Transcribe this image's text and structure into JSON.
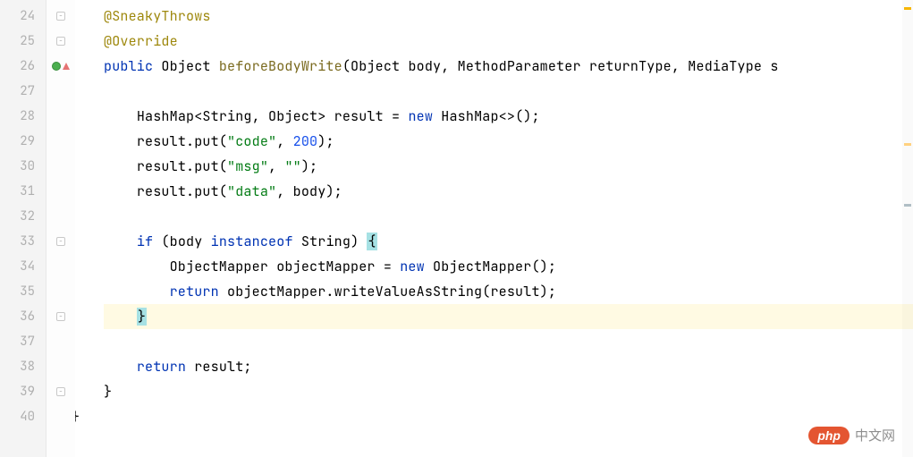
{
  "gutter": {
    "start": 24,
    "end": 40,
    "line26_icon": "override-marker"
  },
  "code": {
    "l24_anno": "@SneakyThrows",
    "l25_anno": "@Override",
    "l26_kw_public": "public",
    "l26_type_object": "Object",
    "l26_method": "beforeBodyWrite",
    "l26_p_object": "Object",
    "l26_p_body": "body",
    "l26_p_mp": "MethodParameter",
    "l26_p_rt": "returnType",
    "l26_p_mt": "MediaType",
    "l26_p_s": "s",
    "l28_type_hm": "HashMap",
    "l28_gen_str": "String",
    "l28_gen_obj": "Object",
    "l28_var": "result",
    "l28_kw_new": "new",
    "l28_ctor": "HashMap",
    "l29_recv": "result",
    "l29_put": "put",
    "l29_key": "\"code\"",
    "l29_val": "200",
    "l30_recv": "result",
    "l30_put": "put",
    "l30_key": "\"msg\"",
    "l30_val": "\"\"",
    "l31_recv": "result",
    "l31_put": "put",
    "l31_key": "\"data\"",
    "l31_val": "body",
    "l33_kw_if": "if",
    "l33_body": "body",
    "l33_kw_iof": "instanceof",
    "l33_str": "String",
    "l34_type_om": "ObjectMapper",
    "l34_var": "objectMapper",
    "l34_kw_new": "new",
    "l34_ctor": "ObjectMapper",
    "l35_kw_return": "return",
    "l35_recv": "objectMapper",
    "l35_call": "writeValueAsString",
    "l35_arg": "result",
    "l38_kw_return": "return",
    "l38_var": "result"
  },
  "watermark": {
    "badge": "php",
    "text": "中文网"
  }
}
